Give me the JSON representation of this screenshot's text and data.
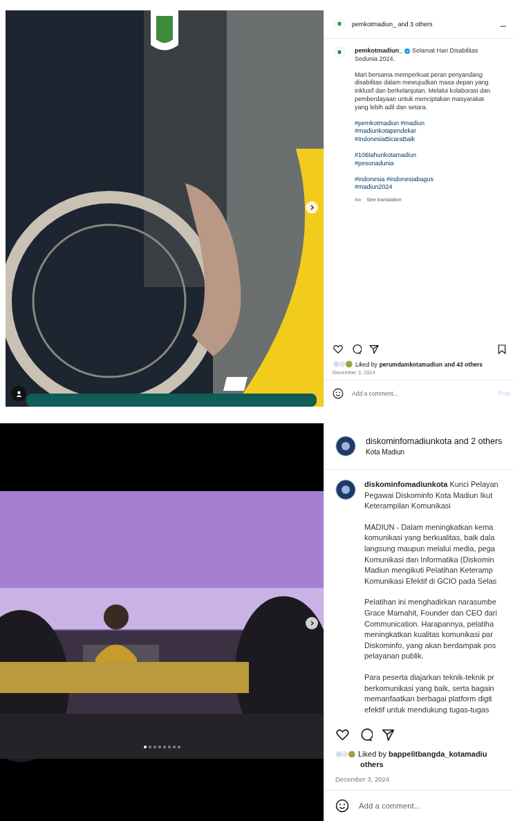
{
  "posts": [
    {
      "media": {
        "kind": "picture",
        "next_button": true,
        "tag_button": true
      },
      "header": {
        "title": "pemkotmadiun_ and 3 others",
        "menu": "..."
      },
      "caption": {
        "author": "pemkotmadiun_",
        "verified": true,
        "first_lines": [
          "Selamat Hari Disabilitas",
          "Sedunia 2024."
        ],
        "paragraphs": [
          {
            "kind": "text",
            "lines": [
              "Mari bersama memperkuat peran penyandang",
              "disabilitas dalam mewujudkan masa depan yang",
              "inklusif dan berkelanjutan. Melalui kolaborasi dan",
              "pemberdayaan untuk menciptakan masyarakat",
              "yang lebih adil dan setara."
            ]
          },
          {
            "kind": "hashtags",
            "lines": [
              "#pemkotmadiun #madiun",
              "#madiunkotapendekar",
              "#IndonesiaBicaraBaik"
            ]
          },
          {
            "kind": "hashtags",
            "lines": [
              "#106tahunkotamadiun",
              "#pesonadunia"
            ]
          },
          {
            "kind": "hashtags",
            "lines": [
              "#indonesia #indonesiabagus",
              "#madiun2024"
            ]
          }
        ],
        "age": "4w",
        "translate": "See translation"
      },
      "actions": [
        {
          "kind": "like"
        },
        {
          "kind": "comment"
        },
        {
          "kind": "share"
        },
        {
          "kind": "save"
        }
      ],
      "likes": [
        {
          "prefix": "Liked by",
          "user": "perumdamkotamadiun",
          "suffix": "and 43 others"
        }
      ],
      "date": "December 3, 2024",
      "comment": {
        "placeholder": "Add a comment...",
        "post_button": "Post"
      }
    },
    {
      "media": {
        "kind": "picture",
        "next_button": true,
        "tag_button": false,
        "dots": [
          {
            "selected": true
          },
          {
            "selected": false
          },
          {
            "selected": false
          },
          {
            "selected": false
          },
          {
            "selected": false
          },
          {
            "selected": false
          },
          {
            "selected": false
          },
          {
            "selected": false
          }
        ]
      },
      "header": {
        "title": "diskominfomadiunkota and 2 others",
        "subtitle": "Kota Madiun"
      },
      "caption": {
        "author": "diskominfomadiunkota",
        "verified": false,
        "first_lines": [
          "Kunci Pelayan",
          "Pegawai Diskominfo Kota Madiun Ikut",
          "Keterampilan Komunikasi"
        ],
        "paragraphs": [
          {
            "kind": "text",
            "lines": [
              "MADIUN - Dalam meningkatkan kema",
              "komunikasi yang berkualitas, baik dala",
              "langsung maupun melalui media, pega",
              "Komunikasi dan Informatika (Diskomin",
              "Madiun mengikuti Pelatihan Keteramp",
              "Komunikasi Efektif di GCIO pada Selas"
            ]
          },
          {
            "kind": "text",
            "lines": [
              "Pelatihan ini menghadirkan narasumbe",
              "Grace Mamahit, Founder dan CEO dari",
              "Communication. Harapannya, pelatiha",
              "meningkatkan kualitas komunikasi par",
              "Diskominfo, yang akan berdampak pos",
              "pelayanan publik."
            ]
          },
          {
            "kind": "text",
            "lines": [
              "Para peserta diajarkan teknik-teknik pr",
              "berkomunikasi yang baik, serta bagain",
              "memanfaatkan berbagai platform digit",
              "efektif untuk mendukung tugas-tugas"
            ]
          }
        ]
      },
      "actions": [
        {
          "kind": "like"
        },
        {
          "kind": "comment"
        },
        {
          "kind": "share"
        }
      ],
      "likes": [
        {
          "prefix": "Liked by",
          "user": "bappelitbangda_kotamadiu"
        },
        {
          "suffix": "others"
        }
      ],
      "date": "December 3, 2024",
      "comment": {
        "placeholder": "Add a comment..."
      }
    }
  ]
}
